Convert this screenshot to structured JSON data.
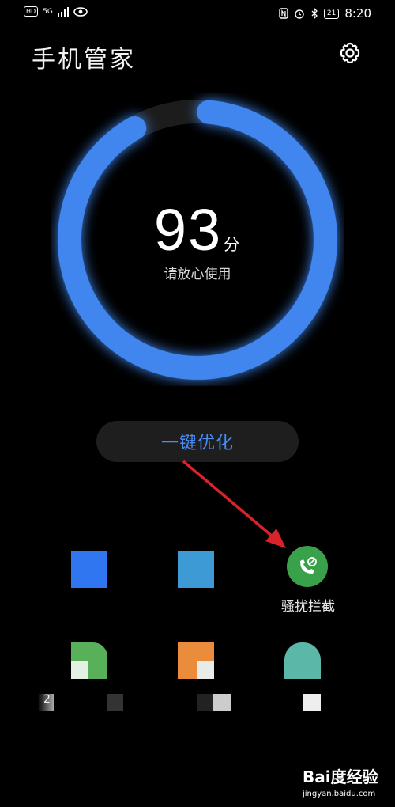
{
  "status_bar": {
    "hd": "HD",
    "network": "5G",
    "battery": "21",
    "time": "8:20"
  },
  "header": {
    "title": "手机管家"
  },
  "score": {
    "value": "93",
    "unit": "分",
    "subtitle": "请放心使用",
    "ring_color": "#3f86ee"
  },
  "optimize": {
    "label": "一键优化"
  },
  "apps": {
    "harassment_block": {
      "label": "骚扰拦截",
      "color": "#3aa14b"
    }
  },
  "fragments": {
    "digit": "2"
  },
  "watermark": {
    "text": "Bai度经验",
    "url": "jingyan.baidu.com"
  },
  "colors": {
    "accent": "#4a8df5",
    "arrow": "#d8232a"
  }
}
